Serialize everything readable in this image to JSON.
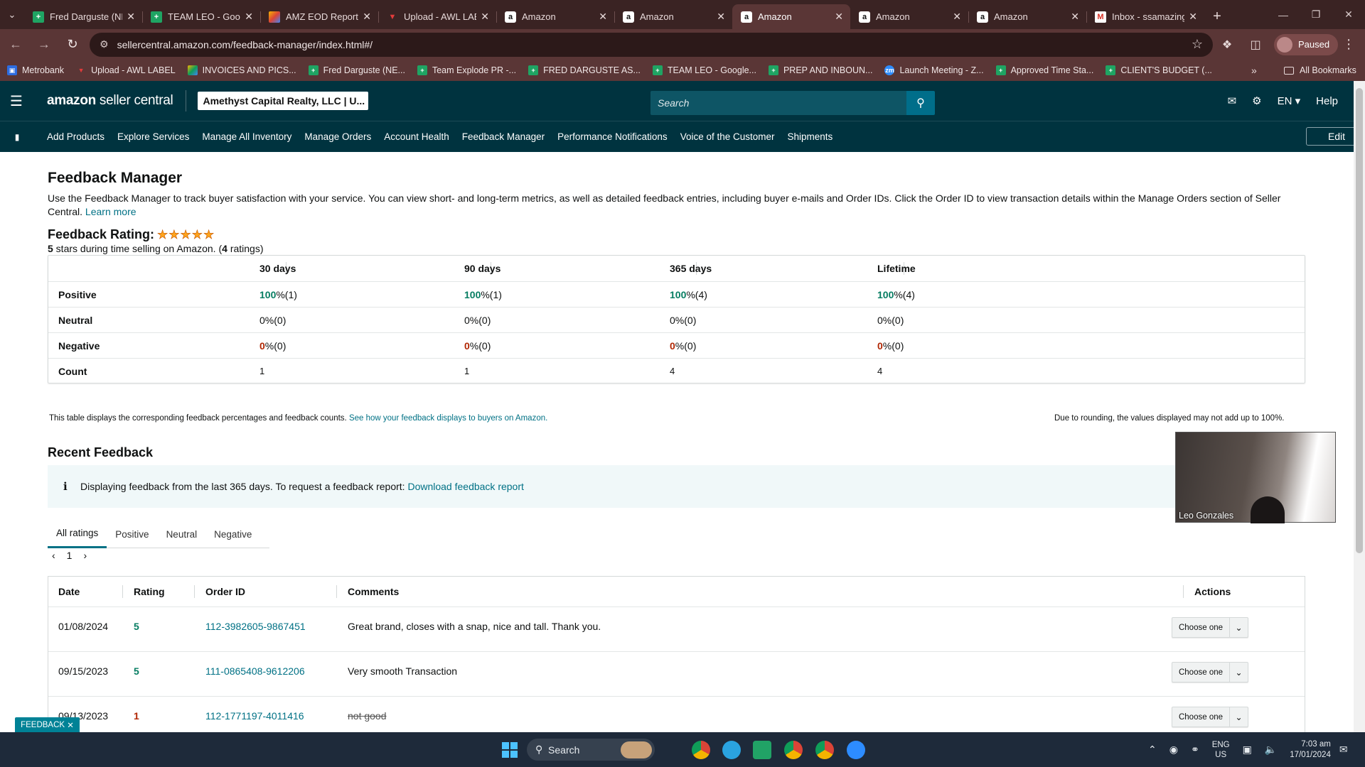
{
  "browser": {
    "tabs": [
      {
        "title": "Fred Darguste (NE",
        "favicon": "sheet"
      },
      {
        "title": "TEAM LEO - Goog",
        "favicon": "sheet"
      },
      {
        "title": "AMZ EOD Report",
        "favicon": "eod"
      },
      {
        "title": "Upload - AWL LAB",
        "favicon": "awl"
      },
      {
        "title": "Amazon",
        "favicon": "amz"
      },
      {
        "title": "Amazon",
        "favicon": "amz"
      },
      {
        "title": "Amazon",
        "favicon": "amz",
        "active": true
      },
      {
        "title": "Amazon",
        "favicon": "amz"
      },
      {
        "title": "Amazon",
        "favicon": "amz"
      },
      {
        "title": "Inbox - ssamazing",
        "favicon": "gmail"
      }
    ],
    "url": "sellercentral.amazon.com/feedback-manager/index.html#/",
    "profile_label": "Paused",
    "bookmarks": [
      {
        "label": "Metrobank",
        "icon": "bank"
      },
      {
        "label": "Upload - AWL LABEL",
        "icon": "awl"
      },
      {
        "label": "INVOICES AND PICS...",
        "icon": "drive"
      },
      {
        "label": "Fred Darguste (NE...",
        "icon": "sheet"
      },
      {
        "label": "Team Explode PR -...",
        "icon": "sheet"
      },
      {
        "label": "FRED DARGUSTE AS...",
        "icon": "sheet"
      },
      {
        "label": "TEAM LEO - Google...",
        "icon": "sheet"
      },
      {
        "label": "PREP AND INBOUN...",
        "icon": "sheet"
      },
      {
        "label": "Launch Meeting - Z...",
        "icon": "zoom"
      },
      {
        "label": "Approved Time Sta...",
        "icon": "sheet"
      },
      {
        "label": "CLIENT'S BUDGET (...",
        "icon": "sheet"
      }
    ],
    "all_bookmarks_label": "All Bookmarks"
  },
  "header": {
    "logo_brand": "amazon",
    "logo_rest": " seller central",
    "account": "Amethyst Capital Realty, LLC | U...",
    "search_placeholder": "Search",
    "lang": "EN",
    "help": "Help"
  },
  "nav": {
    "items": [
      "Add Products",
      "Explore Services",
      "Manage All Inventory",
      "Manage Orders",
      "Account Health",
      "Feedback Manager",
      "Performance Notifications",
      "Voice of the Customer",
      "Shipments"
    ],
    "edit": "Edit"
  },
  "page": {
    "title": "Feedback Manager",
    "intro": "Use the Feedback Manager to track buyer satisfaction with your service. You can view short- and long-term metrics, as well as detailed feedback entries, including buyer e-mails and Order IDs. Click the Order ID to view transaction details within the Manage Orders section of Seller Central.",
    "learn_more": "Learn more",
    "rating_title": "Feedback Rating:",
    "stars": 5,
    "rating_sub_stars": "5",
    "rating_sub_mid": " stars during time selling on Amazon. (",
    "rating_sub_count": "4",
    "rating_sub_end": " ratings)"
  },
  "summary": {
    "periods": [
      "30 days",
      "90 days",
      "365 days",
      "Lifetime"
    ],
    "rows": [
      {
        "label": "Positive",
        "values": [
          {
            "pct": "100",
            "n": " %(1)"
          },
          {
            "pct": "100",
            "n": " %(1)"
          },
          {
            "pct": "100",
            "n": " %(4)"
          },
          {
            "pct": "100",
            "n": " %(4)"
          }
        ]
      },
      {
        "label": "Neutral",
        "values": [
          {
            "pct": "0",
            "n": " %(0)"
          },
          {
            "pct": "0",
            "n": " %(0)"
          },
          {
            "pct": "0",
            "n": " %(0)"
          },
          {
            "pct": "0",
            "n": " %(0)"
          }
        ]
      },
      {
        "label": "Negative",
        "values": [
          {
            "pct": "0",
            "n": " %(0)"
          },
          {
            "pct": "0",
            "n": " %(0)"
          },
          {
            "pct": "0",
            "n": " %(0)"
          },
          {
            "pct": "0",
            "n": " %(0)"
          }
        ]
      }
    ],
    "count_label": "Count",
    "counts": [
      "1",
      "1",
      "4",
      "4"
    ],
    "note": "This table displays the corresponding feedback percentages and feedback counts.",
    "note_link": "See how your feedback displays to buyers on Amazon.",
    "rounding_note": "Due to rounding, the values displayed may not add up to 100%."
  },
  "recent": {
    "title": "Recent Feedback",
    "info": "Displaying feedback from the last 365 days. To request a feedback report:",
    "info_link": "Download feedback report",
    "tabs": [
      "All ratings",
      "Positive",
      "Neutral",
      "Negative"
    ],
    "page": "1",
    "columns": [
      "Date",
      "Rating",
      "Order ID",
      "Comments",
      "Actions"
    ],
    "rows": [
      {
        "date": "01/08/2024",
        "rating": "5",
        "order": "112-3982605-9867451",
        "comment": "Great brand, closes with a snap, nice and tall. Thank you.",
        "action": "Choose one"
      },
      {
        "date": "09/15/2023",
        "rating": "5",
        "order": "111-0865408-9612206",
        "comment": "Very smooth Transaction",
        "action": "Choose one"
      },
      {
        "date": "09/13/2023",
        "rating": "1",
        "order": "112-1771197-4011416",
        "comment": "not good",
        "action": "Choose one",
        "struck": true
      }
    ]
  },
  "feedback_tab": "FEEDBACK",
  "video": {
    "name": "Leo Gonzales"
  },
  "taskbar": {
    "search": "Search",
    "lang_top": "ENG",
    "lang_bottom": "US",
    "time": "7:03 am",
    "date": "17/01/2024"
  }
}
